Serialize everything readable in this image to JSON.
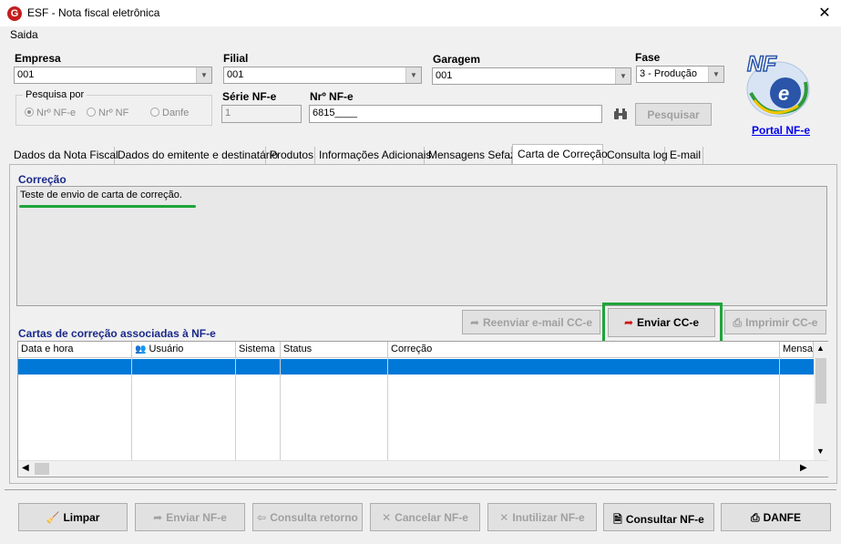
{
  "window": {
    "title": "ESF - Nota fiscal eletrônica",
    "app_icon": "G"
  },
  "menu": {
    "saida": "Saida"
  },
  "header": {
    "empresa_label": "Empresa",
    "empresa_value": "001",
    "filial_label": "Filial",
    "filial_value": "001",
    "garagem_label": "Garagem",
    "garagem_value": "001",
    "fase_label": "Fase",
    "fase_value": "3 - Produção",
    "pesquisa_label": "Pesquisa por",
    "radio_nfe": "Nrº NF-e",
    "radio_nf": "Nrº NF",
    "radio_danfe": "Danfe",
    "serie_label": "Série NF-e",
    "serie_value": "1",
    "nr_label": "Nrº NF-e",
    "nr_value": "6815____",
    "pesquisar": "Pesquisar",
    "logo_text": "NF",
    "portal_link": "Portal NF-e"
  },
  "tabs": [
    "Dados da Nota Fiscal",
    "Dados do emitente e destinatário",
    "Produtos",
    "Informações Adicionais",
    "Mensagens Sefaz",
    "Carta de Correção",
    "Consulta log",
    "E-mail"
  ],
  "correcao": {
    "label": "Correção",
    "text": "Teste de envio de carta de correção."
  },
  "cc_buttons": {
    "reenviar": "Reenviar e-mail CC-e",
    "enviar": "Enviar CC-e",
    "imprimir": "Imprimir CC-e"
  },
  "grid": {
    "title": "Cartas de correção associadas à NF-e",
    "columns": [
      "Data e hora",
      "Usuário",
      "Sistema",
      "Status",
      "Correção",
      "Mensa"
    ]
  },
  "footer": {
    "limpar": "Limpar",
    "enviar_nfe": "Enviar NF-e",
    "consulta_retorno": "Consulta retorno",
    "cancelar_nfe": "Cancelar NF-e",
    "inutilizar_nfe": "Inutilizar NF-e",
    "consultar_nfe": "Consultar NF-e",
    "danfe": "DANFE"
  },
  "colors": {
    "highlight": "#1ea53a",
    "selection": "#0078d7",
    "link": "#0000ee"
  }
}
